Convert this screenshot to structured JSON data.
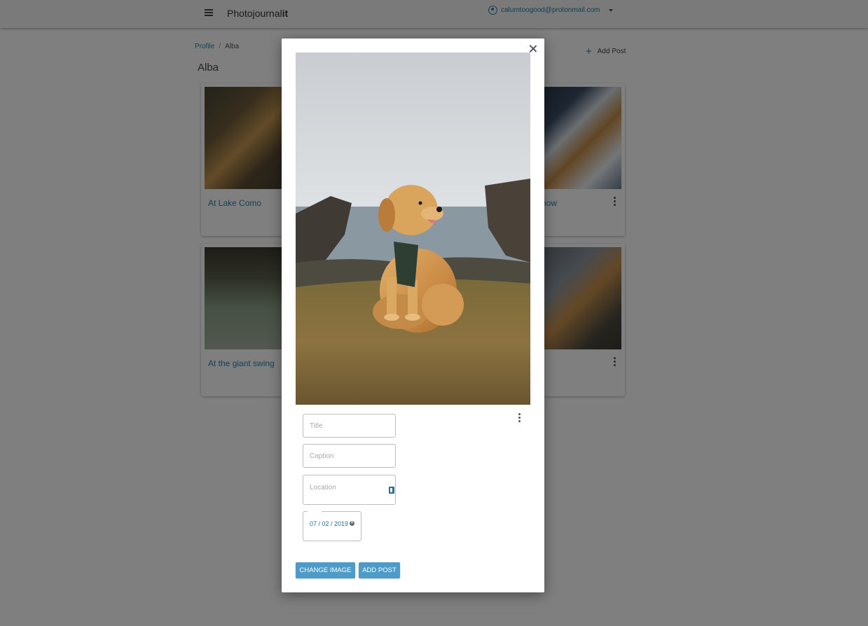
{
  "appbar": {
    "brand_prefix": "Photojournal",
    "brand_suffix": "it",
    "account_email": "calumtoogood@protonmail.com"
  },
  "breadcrumb": {
    "root": "Profile",
    "separator": "/",
    "current": "Alba"
  },
  "add_post_label": "Add Post",
  "page_title": "Alba",
  "cards": [
    {
      "title": "At Lake Como"
    },
    {
      "title": "e snow"
    },
    {
      "title": "At the giant swing"
    },
    {
      "title": ""
    }
  ],
  "dialog": {
    "title_placeholder": "Title",
    "caption_placeholder": "Caption",
    "location_placeholder": "Location",
    "date_value": "07 / 02 / 2019",
    "change_image_label": "CHANGE IMAGE",
    "add_post_label": "ADD POST"
  },
  "colors": {
    "accent": "#4c9bc8",
    "link": "#2d7fa8",
    "overlay": "rgba(0,0,0,0.5)"
  }
}
